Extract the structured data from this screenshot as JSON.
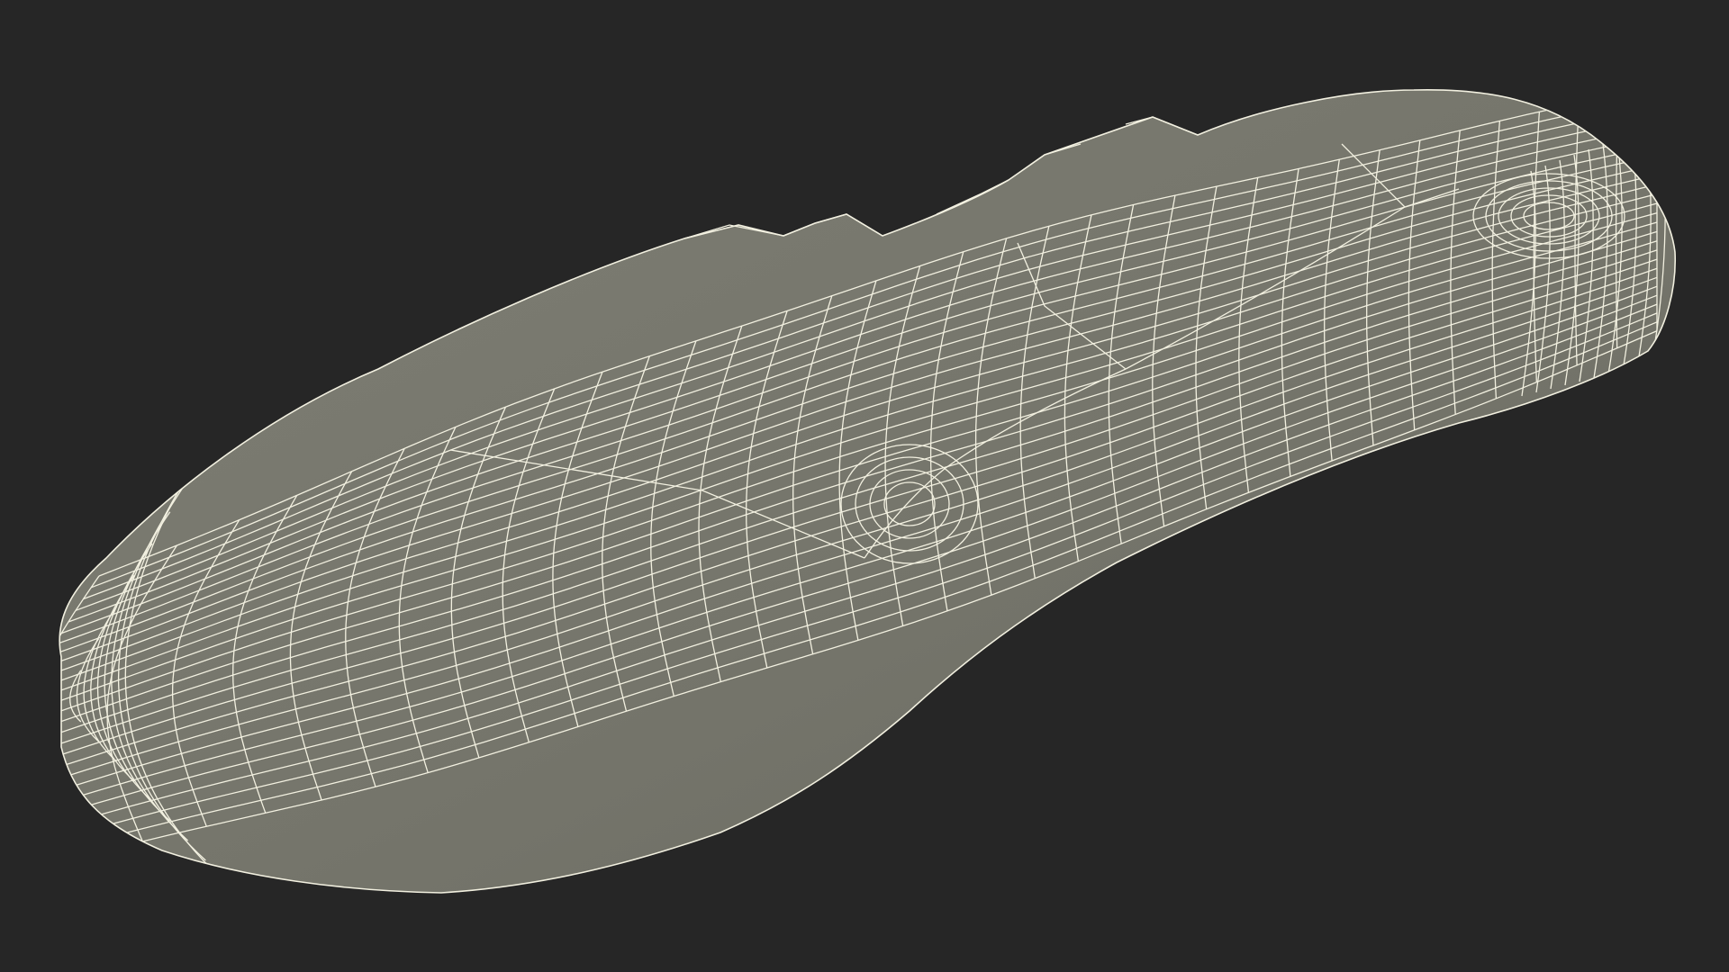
{
  "scene": {
    "object": "wireframe-mesh",
    "colors": {
      "background": "#262626",
      "surface": "#75756b",
      "surface_shade": "#6a6a61",
      "surface_light": "#7e7e74",
      "wire": "#f2f0e0"
    }
  }
}
